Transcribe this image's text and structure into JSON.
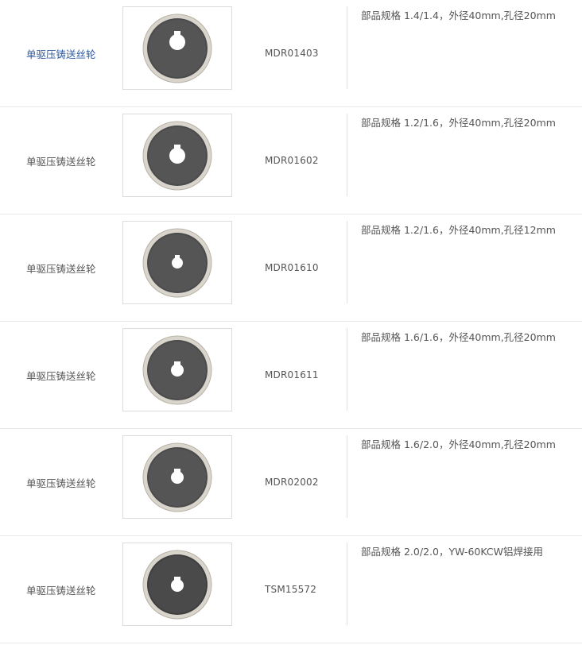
{
  "rows": [
    {
      "name": "单驱压铸送丝轮",
      "code": "MDR01403",
      "spec": "部品规格 1.4/1.4，外径40mm,孔径20mm",
      "link": true
    },
    {
      "name": "单驱压铸送丝轮",
      "code": "MDR01602",
      "spec": "部品规格 1.2/1.6，外径40mm,孔径20mm",
      "link": false
    },
    {
      "name": "单驱压铸送丝轮",
      "code": "MDR01610",
      "spec": "部品规格 1.2/1.6，外径40mm,孔径12mm",
      "link": false
    },
    {
      "name": "单驱压铸送丝轮",
      "code": "MDR01611",
      "spec": "部品规格 1.6/1.6，外径40mm,孔径20mm",
      "link": false
    },
    {
      "name": "单驱压铸送丝轮",
      "code": "MDR02002",
      "spec": "部品规格 1.6/2.0，外径40mm,孔径20mm",
      "link": false
    },
    {
      "name": "单驱压铸送丝轮",
      "code": "TSM15572",
      "spec": "部品规格 2.0/2.0，YW-60KCW铝焊接用",
      "link": false
    }
  ],
  "colors": {
    "link": "#2b5aa0",
    "text": "#555555",
    "border": "#e8e8e8",
    "wheel_face": "#4a4a4a",
    "wheel_rim": "#d8d4cc"
  },
  "icons": {
    "wheel_image": "wire-feed-roller-photo"
  }
}
